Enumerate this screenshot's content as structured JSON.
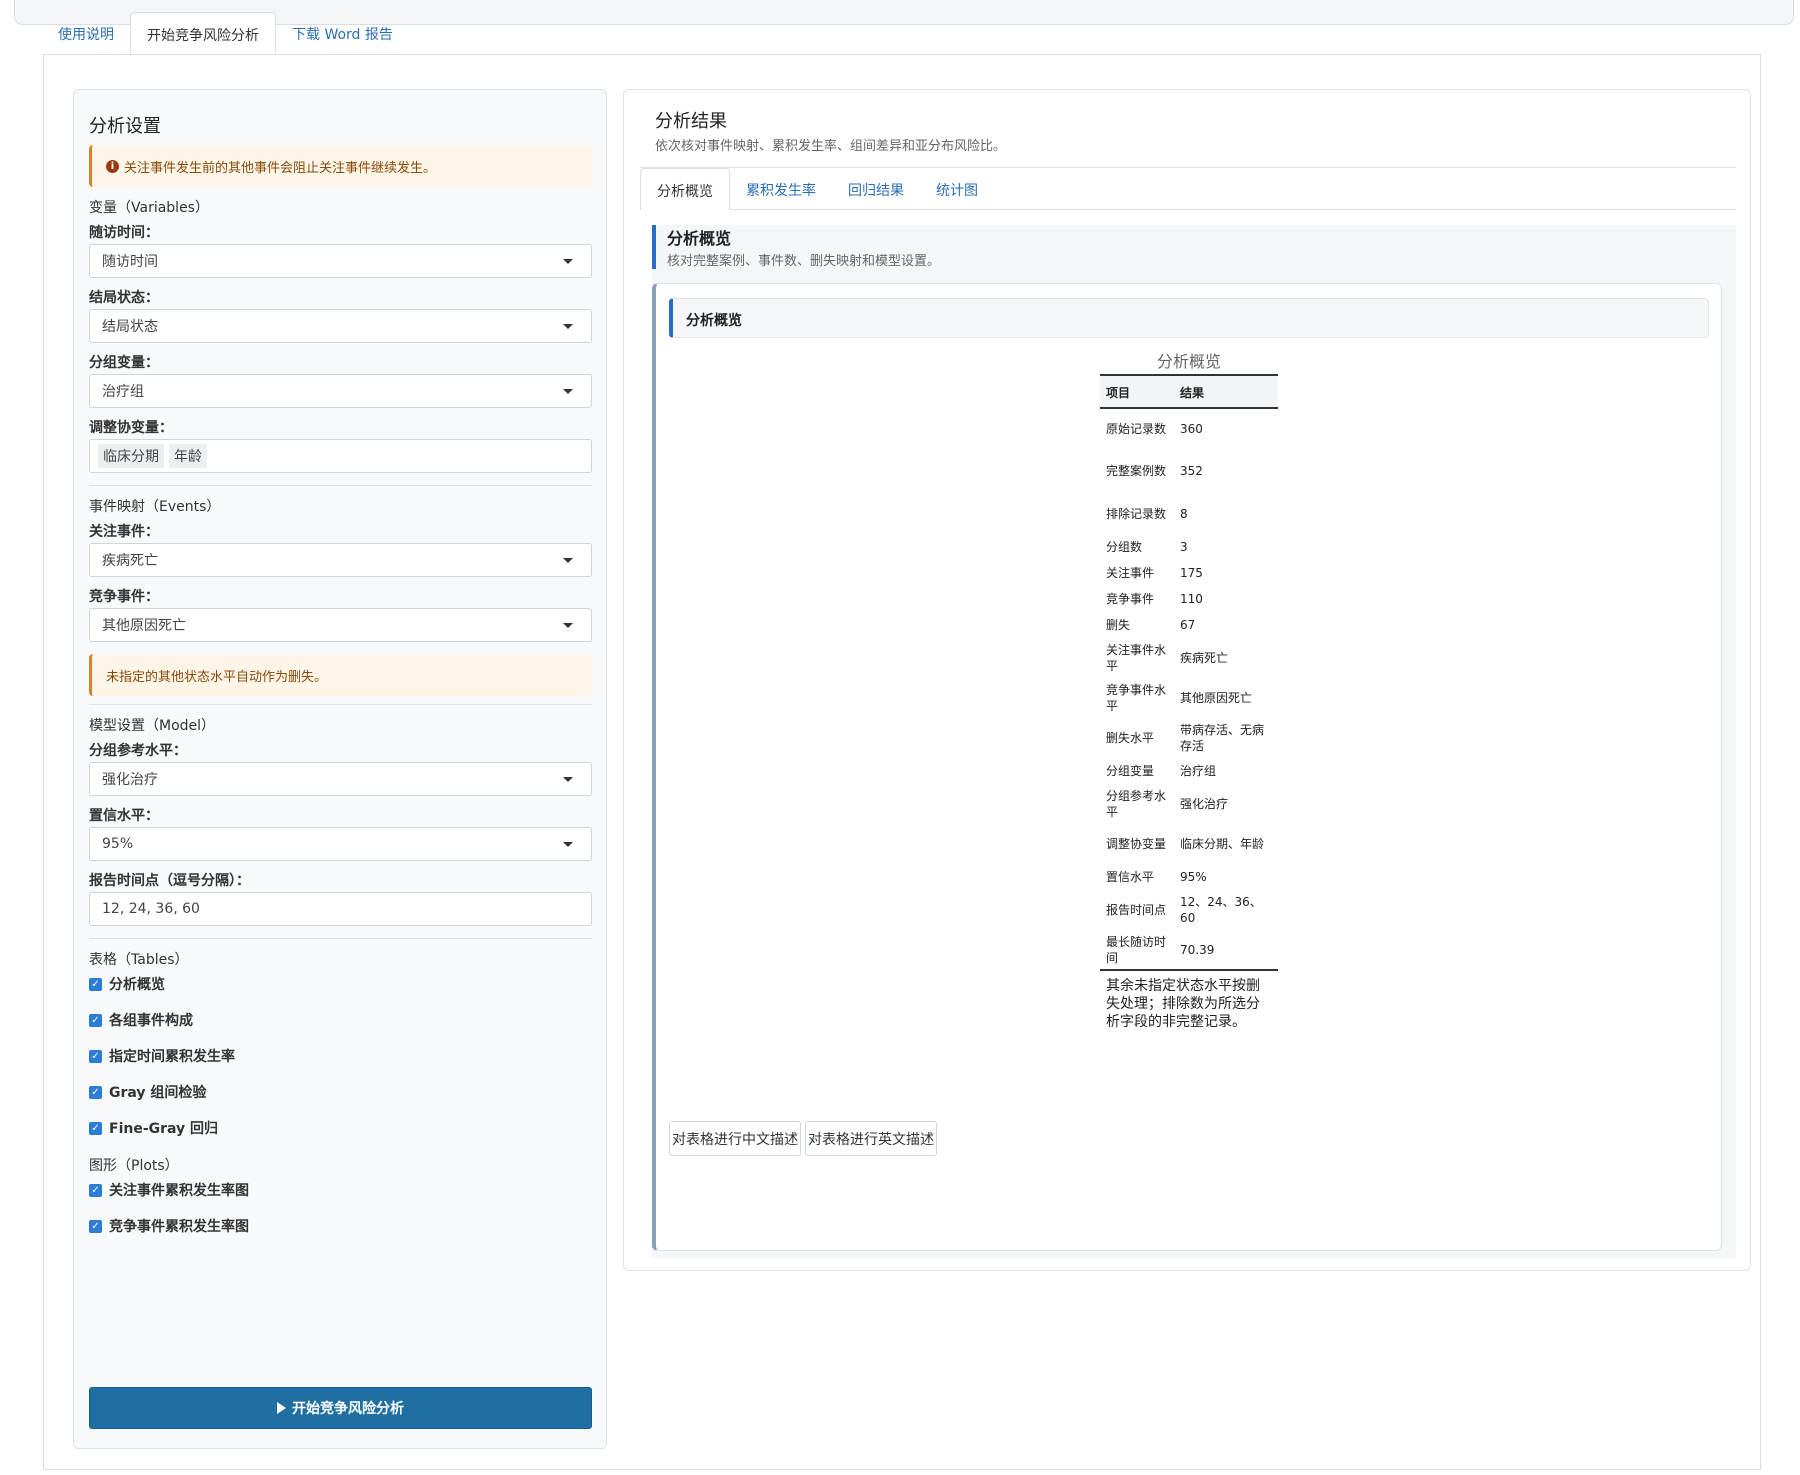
{
  "main_tabs": [
    {
      "label": "使用说明",
      "active": false
    },
    {
      "label": "开始竞争风险分析",
      "active": true
    },
    {
      "label": "下载 Word 报告",
      "active": false
    }
  ],
  "sidebar": {
    "title": "分析设置",
    "alert_top": "关注事件发生前的其他事件会阻止关注事件继续发生。",
    "variables_section": "变量（Variables）",
    "time_label": "随访时间：",
    "time_value": "随访时间",
    "status_label": "结局状态：",
    "status_value": "结局状态",
    "group_label": "分组变量：",
    "group_value": "治疗组",
    "covariates_label": "调整协变量：",
    "covariates": [
      "临床分期",
      "年龄"
    ],
    "events_section": "事件映射（Events）",
    "event_interest_label": "关注事件：",
    "event_interest_value": "疾病死亡",
    "event_compete_label": "竞争事件：",
    "event_compete_value": "其他原因死亡",
    "alert_censor": "未指定的其他状态水平自动作为删失。",
    "model_section": "模型设置（Model）",
    "ref_label": "分组参考水平：",
    "ref_value": "强化治疗",
    "conf_label": "置信水平：",
    "conf_value": "95%",
    "timepoints_label": "报告时间点（逗号分隔）：",
    "timepoints_value": "12, 24, 36, 60",
    "tables_section": "表格（Tables）",
    "tables": [
      "分析概览",
      "各组事件构成",
      "指定时间累积发生率",
      "Gray 组间检验",
      "Fine-Gray 回归"
    ],
    "plots_section": "图形（Plots）",
    "plots": [
      "关注事件累积发生率图",
      "竞争事件累积发生率图"
    ],
    "run_button": "开始竞争风险分析"
  },
  "results": {
    "title": "分析结果",
    "subtitle": "依次核对事件映射、累积发生率、组间差异和亚分布风险比。",
    "tabs": [
      {
        "label": "分析概览",
        "active": true
      },
      {
        "label": "累积发生率",
        "active": false
      },
      {
        "label": "回归结果",
        "active": false
      },
      {
        "label": "统计图",
        "active": false
      }
    ],
    "overview_title": "分析概览",
    "overview_subtitle": "核对完整案例、事件数、删失映射和模型设置。",
    "card_title": "分析概览",
    "table": {
      "caption": "分析概览",
      "headers": [
        "项目",
        "结果"
      ],
      "rows": [
        [
          "原始记录数",
          "360"
        ],
        [
          "完整案例数",
          "352"
        ],
        [
          "排除记录数",
          "8"
        ],
        [
          "分组数",
          "3"
        ],
        [
          "关注事件",
          "175"
        ],
        [
          "竞争事件",
          "110"
        ],
        [
          "删失",
          "67"
        ],
        [
          "关注事件水平",
          "疾病死亡"
        ],
        [
          "竞争事件水平",
          "其他原因死亡"
        ],
        [
          "删失水平",
          "带病存活、无病存活"
        ],
        [
          "分组变量",
          "治疗组"
        ],
        [
          "分组参考水平",
          "强化治疗"
        ],
        [
          "调整协变量",
          "临床分期、年龄"
        ],
        [
          "置信水平",
          "95%"
        ],
        [
          "报告时间点",
          "12、24、36、60"
        ],
        [
          "最长随访时间",
          "70.39"
        ]
      ],
      "note": "其余未指定状态水平按删失处理；排除数为所选分析字段的非完整记录。"
    },
    "btn_cn": "对表格进行中文描述",
    "btn_en": "对表格进行英文描述"
  }
}
